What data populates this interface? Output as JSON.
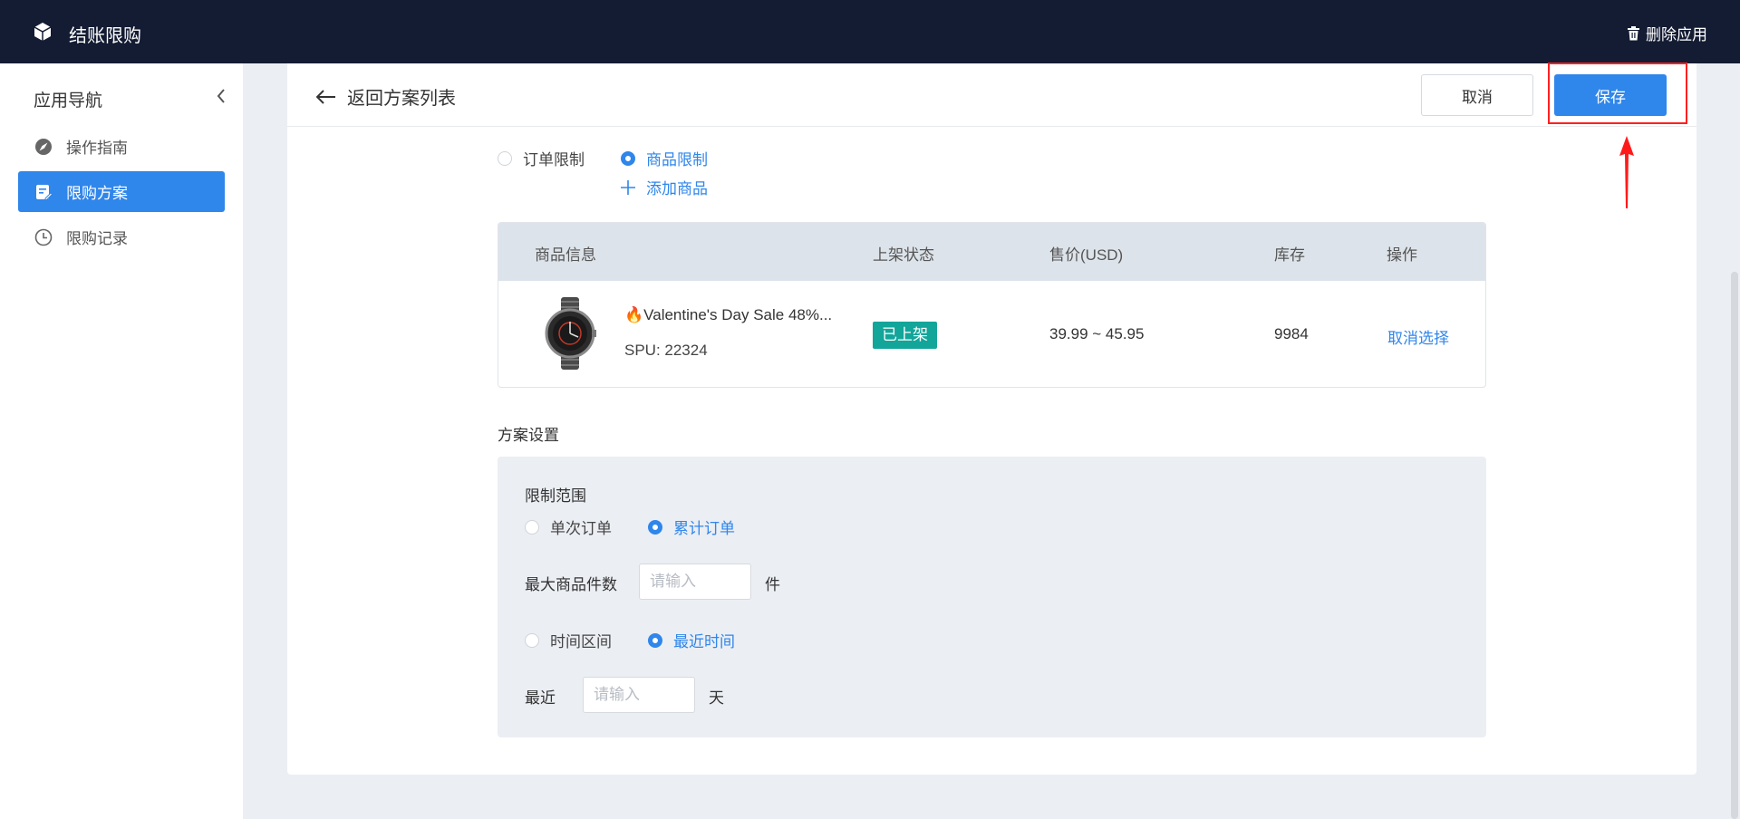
{
  "topbar": {
    "app_title": "结账限购",
    "delete_label": "删除应用"
  },
  "sidebar": {
    "title": "应用导航",
    "items": [
      {
        "label": "操作指南",
        "icon": "navigation-icon",
        "active": false
      },
      {
        "label": "限购方案",
        "icon": "edit-document-icon",
        "active": true
      },
      {
        "label": "限购记录",
        "icon": "clock-icon",
        "active": false
      }
    ]
  },
  "header": {
    "back_label": "返回方案列表",
    "cancel_label": "取消",
    "save_label": "保存"
  },
  "limit_type": {
    "options": [
      {
        "label": "订单限制",
        "checked": false
      },
      {
        "label": "商品限制",
        "checked": true
      }
    ],
    "add_product_label": "添加商品"
  },
  "product_table": {
    "columns": [
      "商品信息",
      "上架状态",
      "售价(USD)",
      "库存",
      "操作"
    ],
    "rows": [
      {
        "name": "🔥Valentine's Day Sale 48%...",
        "spu": "SPU: 22324",
        "status": "已上架",
        "price": "39.99 ~ 45.95",
        "stock": "9984",
        "action": "取消选择"
      }
    ]
  },
  "settings": {
    "section_title": "方案设置",
    "scope_label": "限制范围",
    "scope_options": [
      {
        "label": "单次订单",
        "checked": false
      },
      {
        "label": "累计订单",
        "checked": true
      }
    ],
    "max_qty_label": "最大商品件数",
    "max_qty_placeholder": "请输入",
    "max_qty_unit": "件",
    "time_options": [
      {
        "label": "时间区间",
        "checked": false
      },
      {
        "label": "最近时间",
        "checked": true
      }
    ],
    "recent_label": "最近",
    "recent_placeholder": "请输入",
    "recent_unit": "天"
  },
  "colors": {
    "topbar": "#141c33",
    "primary": "#2f86eb",
    "status_tag": "#12a59a",
    "highlight": "#ff2020"
  }
}
